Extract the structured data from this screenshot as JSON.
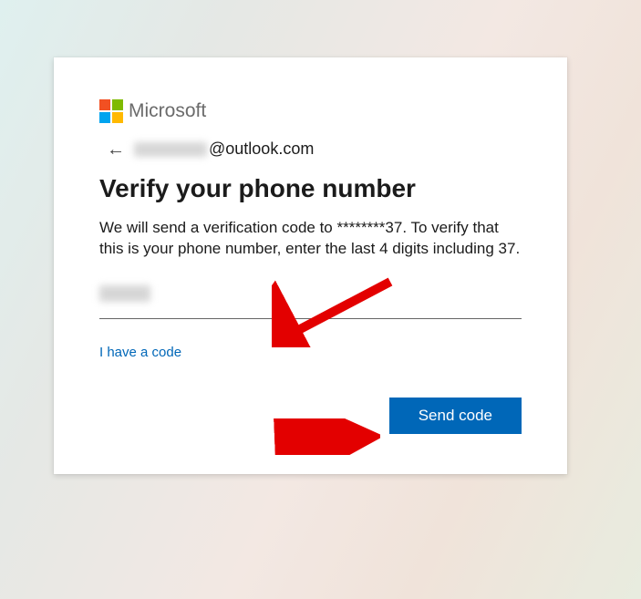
{
  "brand": {
    "name": "Microsoft"
  },
  "account": {
    "email_prefix_redacted": "",
    "email_suffix": "@outlook.com"
  },
  "heading": "Verify your phone number",
  "body": "We will send a verification code to ********37. To verify that this is your phone number, enter the last 4 digits including 37.",
  "input": {
    "value_redacted": "",
    "placeholder": ""
  },
  "links": {
    "have_code": "I have a code"
  },
  "buttons": {
    "send_code": "Send code"
  },
  "annotations": {
    "arrow1": "red arrow pointing to phone input",
    "arrow2": "red arrow pointing to Send code button"
  }
}
